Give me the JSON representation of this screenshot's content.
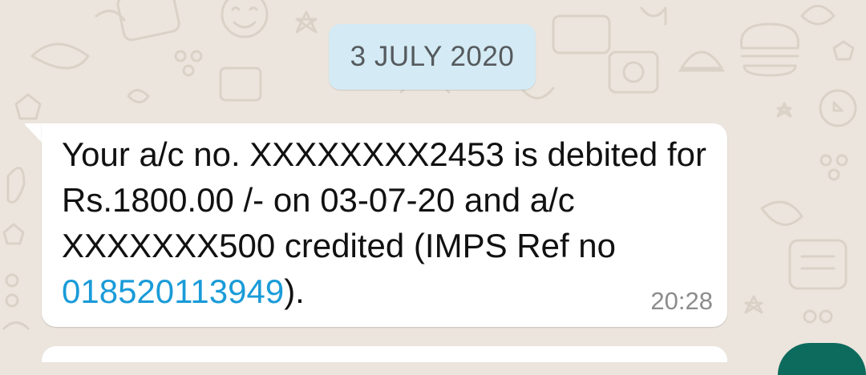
{
  "chat": {
    "date_label": "3 JULY 2020",
    "message": {
      "text_part1": "Your a/c no. XXXXXXXX2453 is debited for Rs.1800.00 /- on 03-07-20 and a/c XXXXXXX500 credited (IMPS Ref no ",
      "ref_number": "018520113949",
      "text_part2": ").",
      "time": "20:28"
    }
  },
  "colors": {
    "wallpaper": "#ece5dd",
    "date_chip": "#d4eaf4",
    "bubble": "#ffffff",
    "link": "#1a9bd8",
    "timestamp": "#8c8c8c"
  }
}
